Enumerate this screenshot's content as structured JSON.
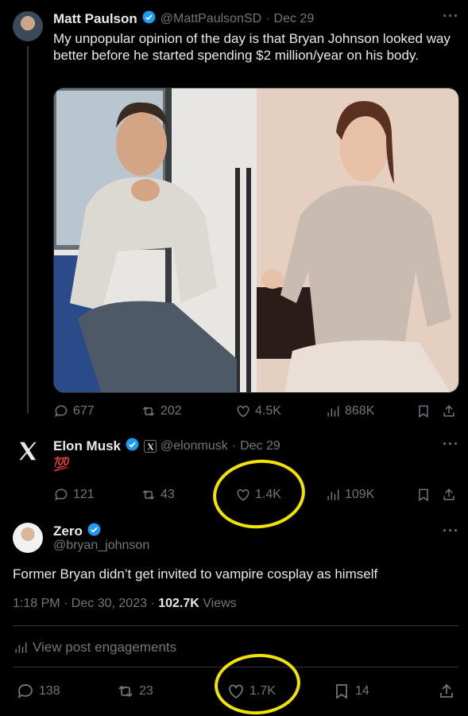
{
  "tweet1": {
    "author_name": "Matt Paulson",
    "handle": "@MattPaulsonSD",
    "date": "Dec 29",
    "text": "My unpopular opinion of the day is that Bryan Johnson looked way better before he started spending $2 million/year on his body.",
    "stats": {
      "replies": "677",
      "reposts": "202",
      "likes": "4.5K",
      "views": "868K"
    }
  },
  "tweet2": {
    "author_name": "Elon Musk",
    "handle": "@elonmusk",
    "date": "Dec 29",
    "text": "💯",
    "stats": {
      "replies": "121",
      "reposts": "43",
      "likes": "1.4K",
      "views": "109K"
    }
  },
  "tweet3": {
    "author_name": "Zero",
    "handle": "@bryan_johnson",
    "text": "Former Bryan didn’t get invited to vampire cosplay as himself",
    "time": "1:18 PM · Dec 30, 2023 · ",
    "views_count": "102.7K",
    "views_label": " Views",
    "engagements": "View post engagements",
    "stats": {
      "replies": "138",
      "reposts": "23",
      "likes": "1.7K",
      "bookmarks": "14"
    }
  },
  "separator": "·",
  "colors": {
    "verified": "#1d9bf0",
    "highlight": "#f2e300",
    "muted": "#71767b"
  }
}
